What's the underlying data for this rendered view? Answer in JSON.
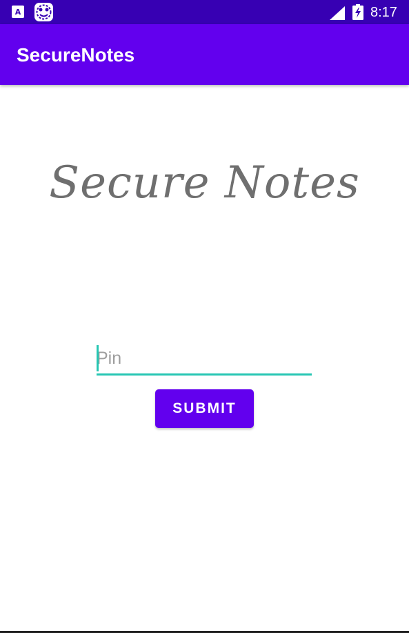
{
  "status_bar": {
    "time": "8:17",
    "notification_icons": [
      "a-icon",
      "app-badge-icon"
    ],
    "signal_icon": "signal-icon",
    "battery_icon": "battery-charging-icon",
    "background_color": "#3700b3"
  },
  "app_bar": {
    "title": "SecureNotes",
    "background_color": "#6200ee"
  },
  "main": {
    "headline": "Secure Notes",
    "pin": {
      "placeholder": "Pin",
      "value": "",
      "accent_color": "#26c6b3"
    },
    "submit_label": "SUBMIT"
  },
  "colors": {
    "primary": "#6200ee",
    "primary_dark": "#3700b3",
    "accent": "#26c6b3",
    "headline": "#6f6f6f"
  }
}
